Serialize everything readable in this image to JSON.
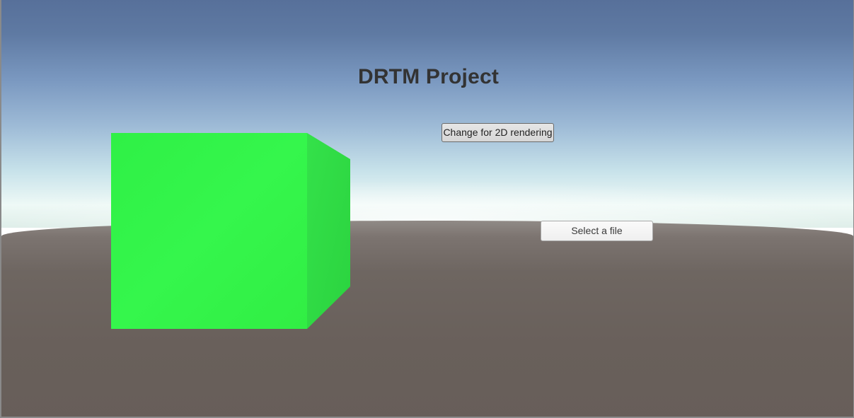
{
  "scene": {
    "title": "DRTM Project",
    "colors": {
      "cube_front": "#33f548",
      "cube_side": "#2fd946",
      "sky_top": "#57709a",
      "horizon": "#eef9f6",
      "ground": "#69605b",
      "title_text": "#333333"
    }
  },
  "buttons": {
    "change_render_label": "Change for 2D rendering",
    "select_file_label": "Select a file"
  }
}
